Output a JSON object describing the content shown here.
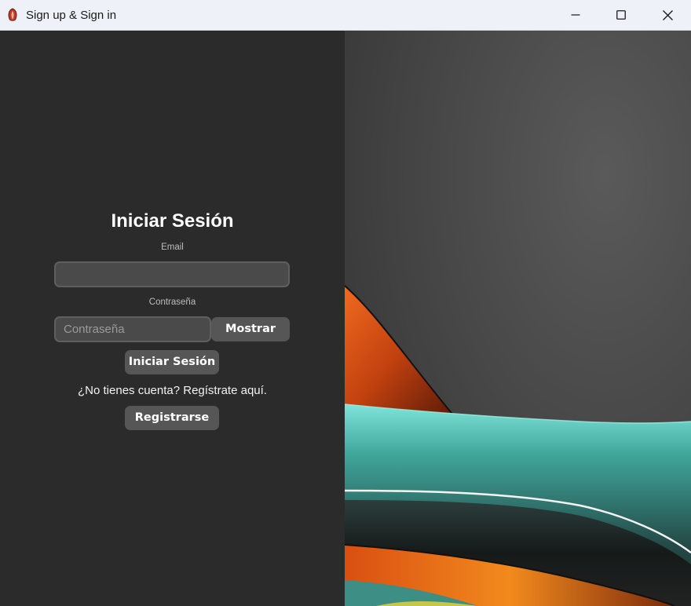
{
  "window": {
    "title": "Sign up & Sign in",
    "controls": [
      "minimize-icon",
      "maximize-icon",
      "close-icon"
    ]
  },
  "login": {
    "heading": "Iniciar Sesión",
    "email_label": "Email",
    "email_value": "",
    "password_label": "Contraseña",
    "password_placeholder": "Contraseña",
    "show_button": "Mostrar",
    "login_button": "Iniciar Sesión",
    "register_prompt": "¿No tienes cuenta? Regístrate aquí.",
    "register_button": "Registrarse"
  },
  "colors": {
    "background": "#2b2b2b",
    "input_bg": "#4a4a4a",
    "button_bg": "#565656",
    "titlebar": "#eef2f8",
    "accent_orange": "#e0561c",
    "accent_teal": "#5fd0c4"
  }
}
